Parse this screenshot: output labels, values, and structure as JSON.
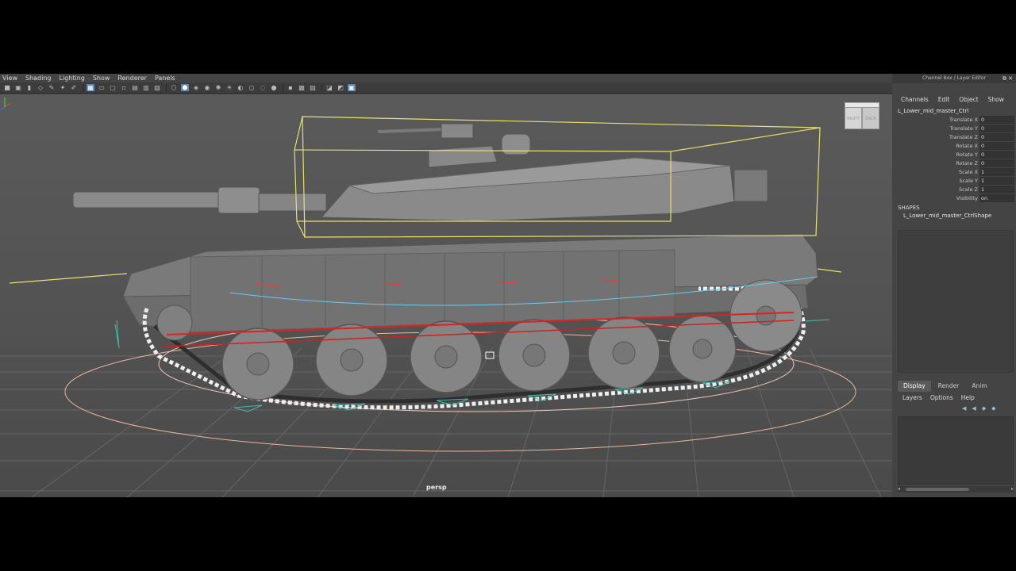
{
  "viewport": {
    "menu": [
      "View",
      "Shading",
      "Lighting",
      "Show",
      "Renderer",
      "Panels"
    ],
    "camera_label": "persp",
    "view_cube": {
      "right": "RIGHT",
      "back": "BACK"
    }
  },
  "side_panel": {
    "title": "Channel Box / Layer Editor",
    "menu": [
      "Channels",
      "Edit",
      "Object",
      "Show"
    ],
    "node_name": "L_Lower_mid_master_Ctrl",
    "attributes": [
      {
        "label": "Translate X",
        "value": "0"
      },
      {
        "label": "Translate Y",
        "value": "0"
      },
      {
        "label": "Translate Z",
        "value": "0"
      },
      {
        "label": "Rotate X",
        "value": "0"
      },
      {
        "label": "Rotate Y",
        "value": "0"
      },
      {
        "label": "Rotate Z",
        "value": "0"
      },
      {
        "label": "Scale X",
        "value": "1"
      },
      {
        "label": "Scale Y",
        "value": "1"
      },
      {
        "label": "Scale Z",
        "value": "1"
      },
      {
        "label": "Visibility",
        "value": "on"
      }
    ],
    "shapes_header": "SHAPES",
    "shape_name": "L_Lower_mid_master_CtrlShape",
    "layer_tabs": [
      "Display",
      "Render",
      "Anim"
    ],
    "layer_menu": [
      "Layers",
      "Options",
      "Help"
    ]
  },
  "colors": {
    "bounding_box": "#e8e070",
    "curve_red": "#e02020",
    "curve_blue": "#66ccee",
    "ground_circle": "#e8b8a0",
    "selected_tab": "#5a5a5a"
  }
}
